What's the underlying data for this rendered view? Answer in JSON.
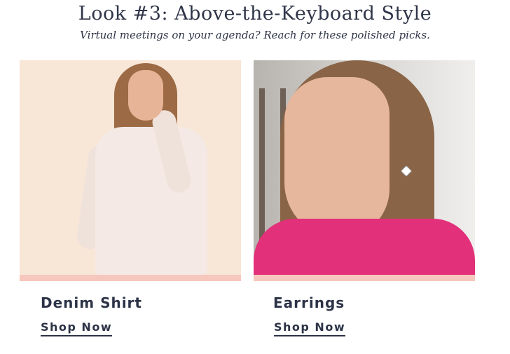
{
  "header": {
    "title": "Look #3: Above-the-Keyboard Style",
    "subtitle": "Virtual meetings on your agenda? Reach for these polished picks."
  },
  "products": [
    {
      "name": "Denim Shirt",
      "cta": "Shop Now",
      "image": "model-in-white-shirt"
    },
    {
      "name": "Earrings",
      "cta": "Shop Now",
      "image": "woman-wearing-earring"
    }
  ],
  "colors": {
    "text": "#2c3347",
    "stripe": "#f6c7bd",
    "shirt_bg": "#f8e6d7",
    "sweater": "#e2307a"
  }
}
